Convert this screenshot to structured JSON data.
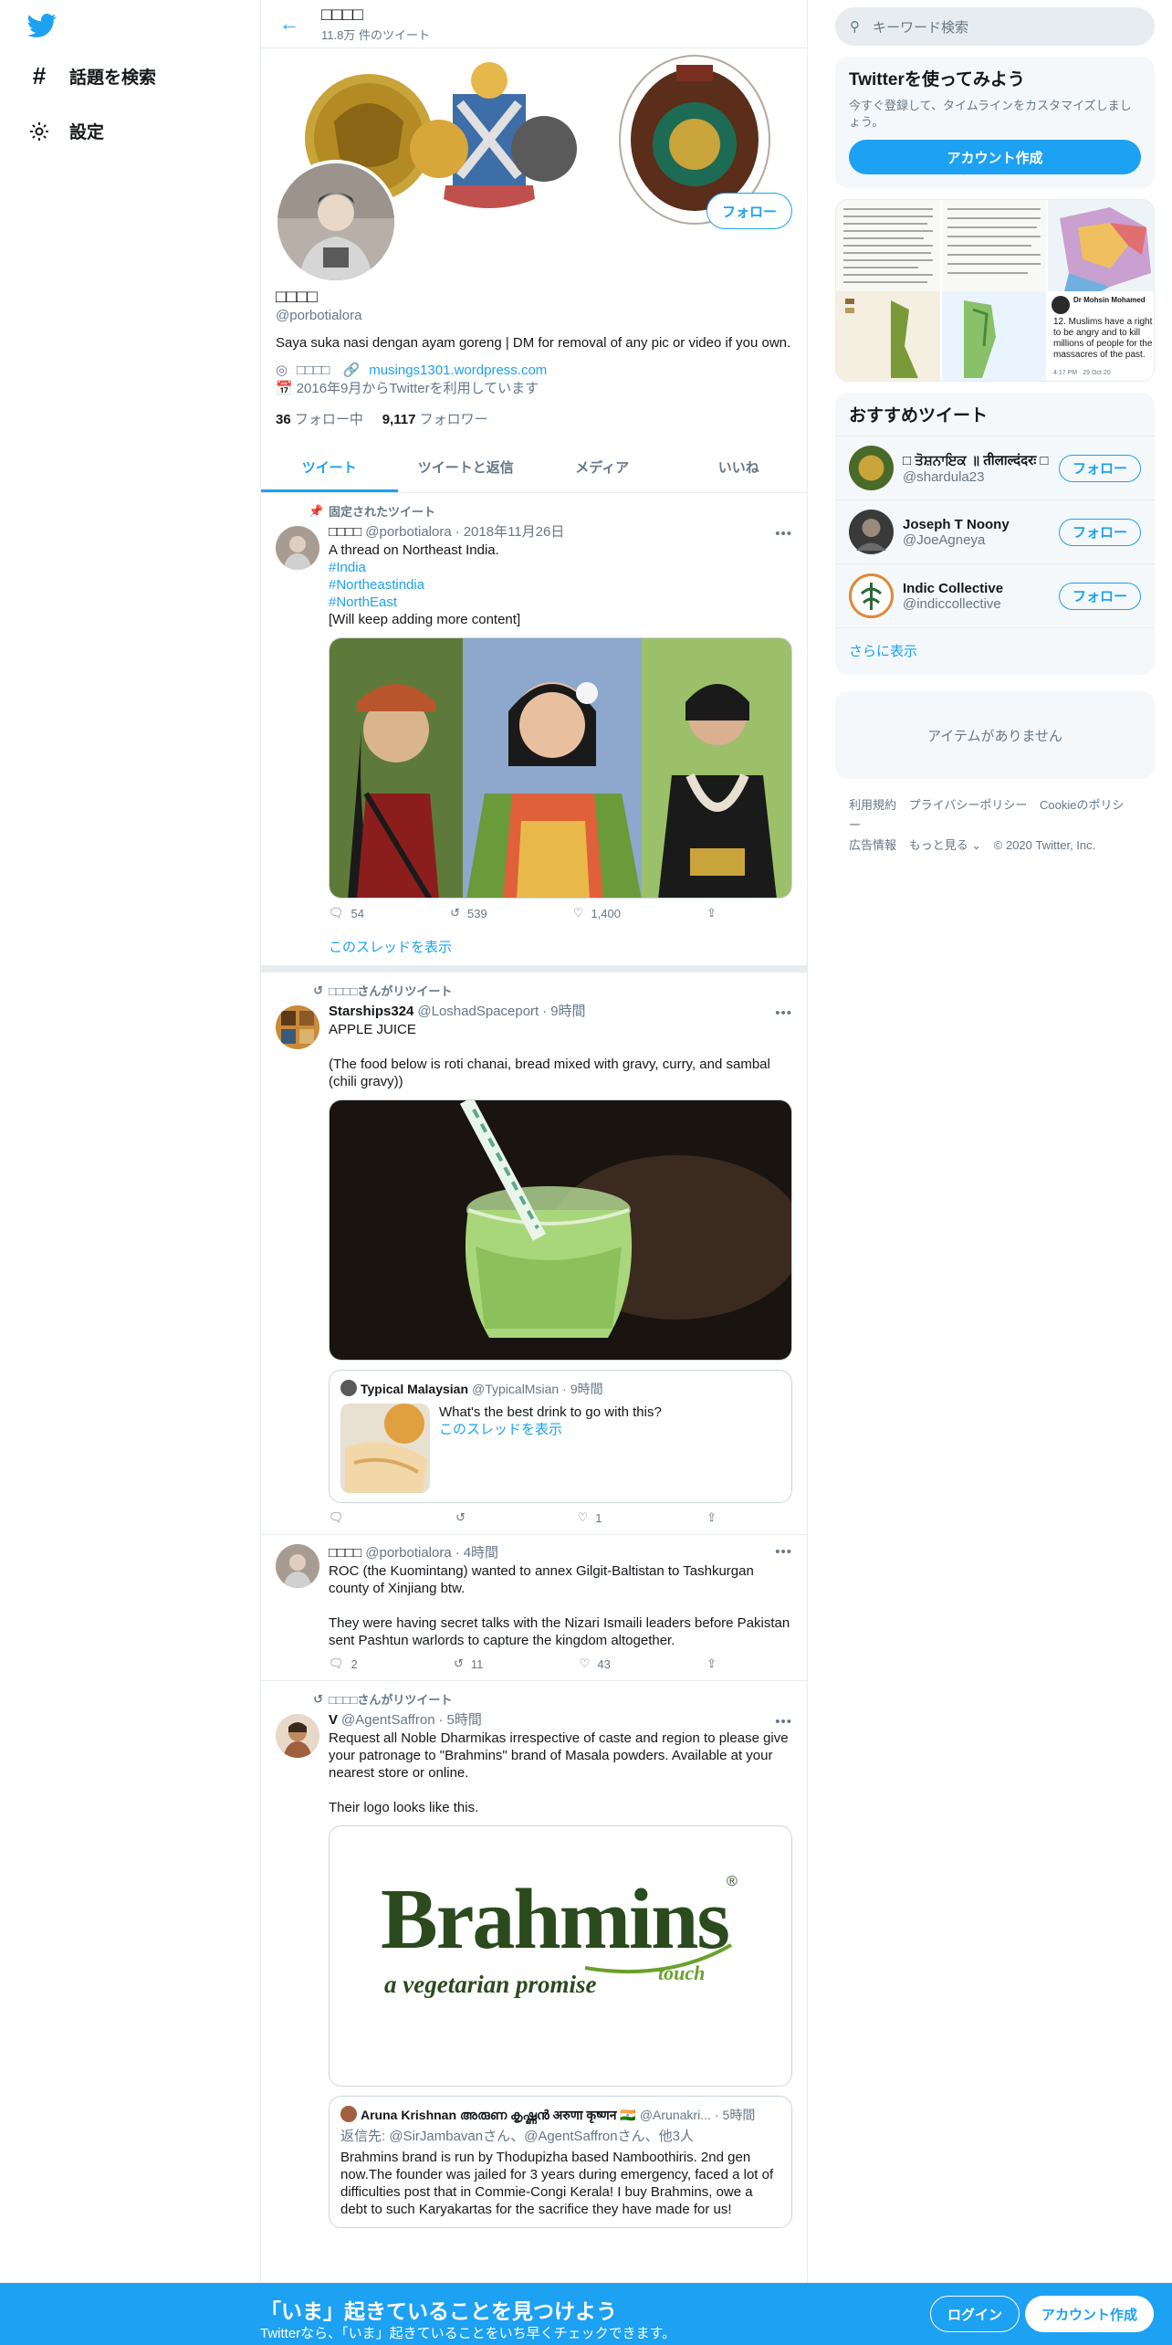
{
  "nav": {
    "explore": "話題を検索",
    "settings": "設定"
  },
  "header": {
    "name": "□□□□",
    "tweet_count": "11.8万 件のツイート"
  },
  "profile": {
    "name": "□□□□",
    "handle": "@porbotialora",
    "bio": "Saya suka nasi dengan ayam goreng | DM for removal of any pic or video if you own.",
    "location": "□□□□",
    "website": "musings1301.wordpress.com",
    "joined": "2016年9月からTwitterを利用しています",
    "following_count": "36",
    "following_label": "フォロー中",
    "followers_count": "9,117",
    "followers_label": "フォロワー",
    "follow_button": "フォロー"
  },
  "tabs": [
    "ツイート",
    "ツイートと返信",
    "メディア",
    "いいね"
  ],
  "tweets": [
    {
      "context": "固定されたツイート",
      "name": "□□□□",
      "handle": "@porbotialora",
      "time": "2018年11月26日",
      "text": "A thread on Northeast India.",
      "hashtags": [
        "#India",
        "#Northeastindia",
        "#NorthEast"
      ],
      "text2": "[Will keep adding more content]",
      "replies": "54",
      "retweets": "539",
      "likes": "1,400",
      "thread_link": "このスレッドを表示"
    },
    {
      "context": "□□□□さんがリツイート",
      "name": "Starships324",
      "handle": "@LoshadSpaceport",
      "time": "9時間",
      "text": "APPLE JUICE\n\n(The food below is roti chanai, bread mixed with gravy, curry, and sambal (chili gravy))",
      "quote_name": "Typical Malaysian",
      "quote_handle": "@TypicalMsian",
      "quote_time": "9時間",
      "quote_text": "What's the best drink to go with this?",
      "quote_link": "このスレッドを表示",
      "replies": "",
      "retweets": "",
      "likes": "1"
    },
    {
      "name": "□□□□",
      "handle": "@porbotialora",
      "time": "4時間",
      "text": "ROC (the Kuomintang) wanted to annex Gilgit-Baltistan to Tashkurgan county of Xinjiang btw.\n\nThey were having secret talks with the Nizari Ismaili leaders before Pakistan sent Pashtun warlords to capture the kingdom altogether.",
      "replies": "2",
      "retweets": "11",
      "likes": "43"
    },
    {
      "context": "□□□□さんがリツイート",
      "name": "V",
      "handle": "@AgentSaffron",
      "time": "5時間",
      "text": "Request all Noble Dharmikas irrespective of caste and region to please give your patronage to \"Brahmins\" brand of Masala powders. Available at your nearest store or online.\n\nTheir logo looks like this.",
      "logo_word": "Brahmins",
      "logo_tagline": "a vegetarian promise",
      "logo_touch": "touch",
      "quote_name": "Aruna Krishnan അരുണ കൃഷ്ണൻ अरुणा कृष्णन 🇮🇳",
      "quote_handle": "@Arunakri...",
      "quote_time": "5時間",
      "quote_reply": "返信先: @SirJambavanさん、@AgentSaffronさん、他3人",
      "quote_text": "Brahmins brand is run by Thodupizha based Namboothiris. 2nd gen now.The founder was jailed for 3 years during emergency, faced a lot of difficulties post that in Commie-Congi Kerala! I buy Brahmins, owe a debt to such Karyakartas for the sacrifice they have made for us!"
    }
  ],
  "right": {
    "search_placeholder": "キーワード検索",
    "signup_title": "Twitterを使ってみよう",
    "signup_sub": "今すぐ登録して、タイムラインをカスタマイズしましょう。",
    "signup_button": "アカウント作成",
    "media_caption_name": "Dr Mohsin Mohamed",
    "media_caption_text": "12. Muslims have a right to be angry and to kill millions of people for the massacres of the past.",
    "media_caption_time": "4:17 PM · 29 Oct 20",
    "who_title": "おすすめツイート",
    "who": [
      {
        "name": "□ ਤੋਸ਼ਨਾਇਕ ॥ तीलाल्दंदरः □",
        "handle": "@shardula23",
        "button": "フォロー"
      },
      {
        "name": "Joseph T Noony",
        "handle": "@JoeAgneya",
        "button": "フォロー"
      },
      {
        "name": "Indic Collective",
        "handle": "@indiccollective",
        "button": "フォロー"
      }
    ],
    "show_more": "さらに表示",
    "empty": "アイテムがありません",
    "footer": [
      "利用規約",
      "プライバシーポリシー",
      "Cookieのポリシー",
      "広告情報",
      "もっと見る ⌄",
      "© 2020 Twitter, Inc."
    ]
  },
  "bottom": {
    "title": "「いま」起きていることを見つけよう",
    "sub": "Twitterなら、「いま」起きていることをいち早くチェックできます。",
    "login": "ログイン",
    "signup": "アカウント作成"
  },
  "colors": {
    "accent": "#1da1f2",
    "text": "#14171a",
    "secondary": "#657786"
  }
}
